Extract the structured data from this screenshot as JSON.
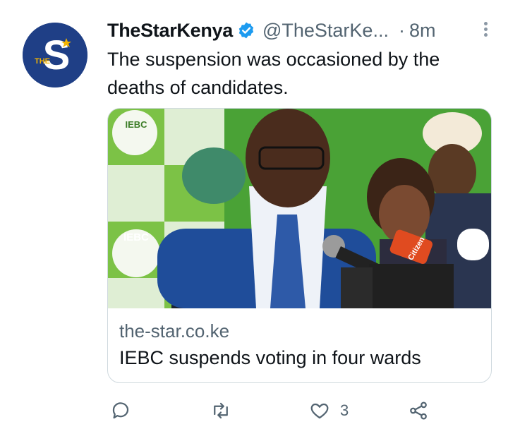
{
  "account": {
    "display_name": "TheStarKenya",
    "handle": "@TheStarKe...",
    "separator": "·",
    "time": "8m",
    "avatar_letter": "S",
    "avatar_small_text": "THE",
    "verified_icon": "verified-badge-icon",
    "colors": {
      "avatar_bg": "#1f3f86",
      "verified": "#1d9bf0"
    }
  },
  "tweet": {
    "text": "The suspension was occasioned by the deaths of candidates."
  },
  "card": {
    "domain": "the-star.co.ke",
    "title": "IEBC suspends voting in four wards",
    "image_signs": [
      "IEBC",
      "IEBC",
      "Citizen"
    ]
  },
  "actions": {
    "reply_icon": "reply-icon",
    "retweet_icon": "retweet-icon",
    "like_icon": "heart-icon",
    "like_count": "3",
    "share_icon": "share-icon"
  }
}
